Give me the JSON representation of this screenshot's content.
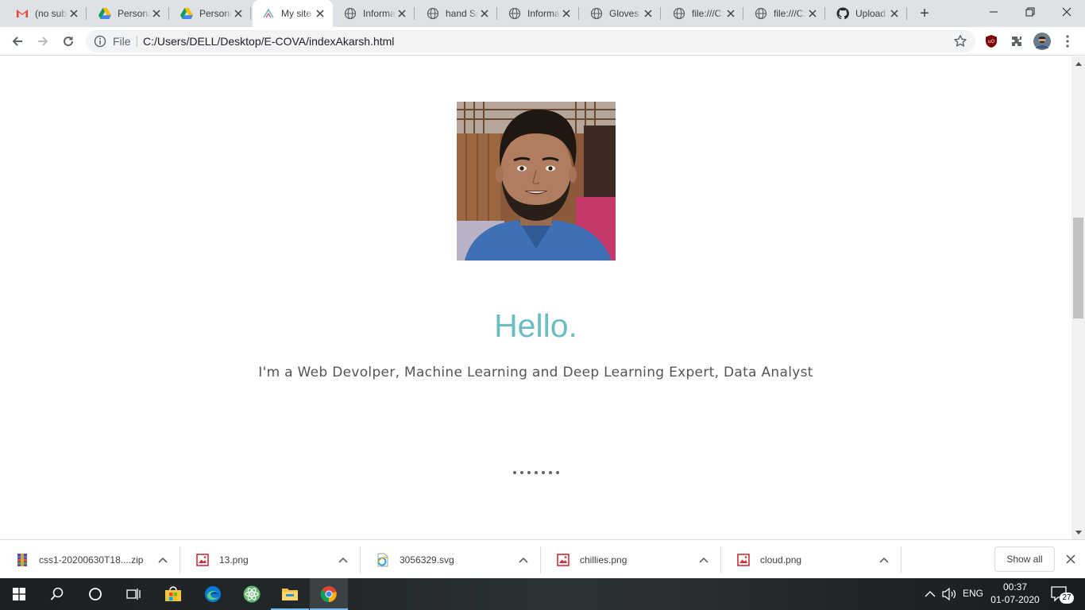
{
  "tabs": [
    {
      "title": "(no subject)",
      "icon": "gmail-icon"
    },
    {
      "title": "Personal",
      "icon": "google-drive-icon"
    },
    {
      "title": "Personal",
      "icon": "google-drive-icon"
    },
    {
      "title": "My site",
      "icon": "site-icon"
    },
    {
      "title": "Information",
      "icon": "globe-icon"
    },
    {
      "title": "hand Sanitizer",
      "icon": "globe-icon"
    },
    {
      "title": "Information",
      "icon": "globe-icon"
    },
    {
      "title": "Gloves",
      "icon": "globe-icon"
    },
    {
      "title": "file:///C:",
      "icon": "globe-icon"
    },
    {
      "title": "file:///C:",
      "icon": "globe-icon"
    },
    {
      "title": "Upload",
      "icon": "github-icon"
    }
  ],
  "active_tab_index": 3,
  "toolbar": {
    "scheme_label": "File",
    "url": "C:/Users/DELL/Desktop/E-COVA/indexAkarsh.html"
  },
  "page": {
    "greeting": "Hello.",
    "tagline": "I'm a Web Devolper, Machine Learning and Deep Learning Expert, Data Analyst",
    "dot_count": 7,
    "accent_color": "#6cbcc3"
  },
  "downloads": {
    "items": [
      {
        "name": "css1-20200630T18....zip",
        "icon": "winrar-archive-icon"
      },
      {
        "name": "13.png",
        "icon": "image-file-icon"
      },
      {
        "name": "3056329.svg",
        "icon": "internet-explorer-file-icon"
      },
      {
        "name": "chillies.png",
        "icon": "image-file-icon"
      },
      {
        "name": "cloud.png",
        "icon": "image-file-icon"
      }
    ],
    "show_all_label": "Show all"
  },
  "taskbar": {
    "language": "ENG",
    "time": "00:37",
    "date": "01-07-2020",
    "notification_count": "27"
  }
}
